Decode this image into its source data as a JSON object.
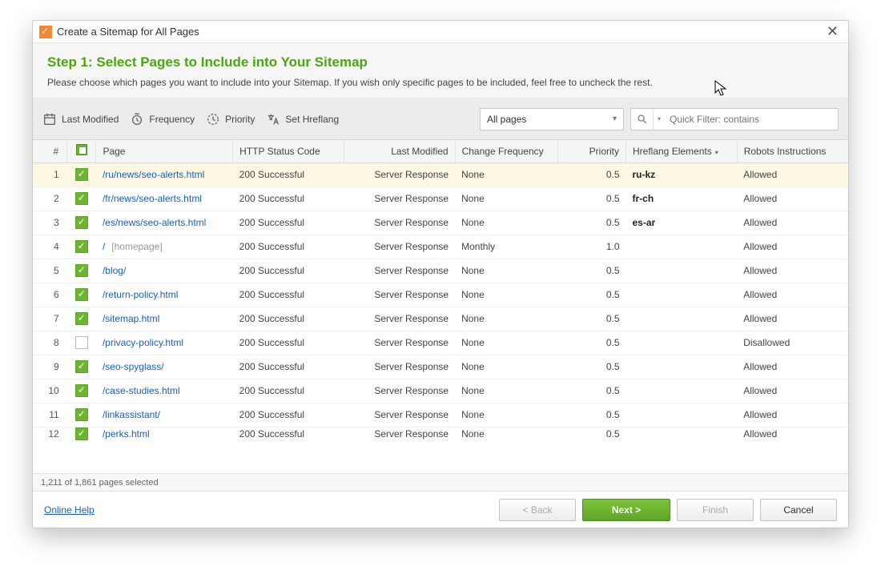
{
  "title": "Create a Sitemap for All Pages",
  "step_title": "Step 1: Select Pages to Include into Your Sitemap",
  "step_desc": "Please choose which pages you want to include into your Sitemap. If you wish only specific pages to be included, feel free to uncheck the rest.",
  "toolbar": {
    "last_modified": "Last Modified",
    "frequency": "Frequency",
    "priority": "Priority",
    "set_hreflang": "Set Hreflang"
  },
  "filter": {
    "dropdown": "All pages",
    "search_placeholder": "Quick Filter: contains"
  },
  "columns": {
    "num": "#",
    "page": "Page",
    "http": "HTTP Status Code",
    "modified": "Last Modified",
    "freq": "Change Frequency",
    "priority": "Priority",
    "hreflang": "Hreflang Elements",
    "robots": "Robots Instructions"
  },
  "rows": [
    {
      "n": "1",
      "chk": true,
      "page": "/ru/news/seo-alerts.html",
      "http": "200 Successful",
      "mod": "Server Response",
      "freq": "None",
      "pri": "0.5",
      "href": "ru-kz",
      "robots": "Allowed",
      "hl": true,
      "bold": true
    },
    {
      "n": "2",
      "chk": true,
      "page": "/fr/news/seo-alerts.html",
      "http": "200 Successful",
      "mod": "Server Response",
      "freq": "None",
      "pri": "0.5",
      "href": "fr-ch",
      "robots": "Allowed",
      "bold": true
    },
    {
      "n": "3",
      "chk": true,
      "page": "/es/news/seo-alerts.html",
      "http": "200 Successful",
      "mod": "Server Response",
      "freq": "None",
      "pri": "0.5",
      "href": "es-ar",
      "robots": "Allowed",
      "bold": true
    },
    {
      "n": "4",
      "chk": true,
      "page": "/",
      "page_note": "[homepage]",
      "http": "200 Successful",
      "mod": "Server Response",
      "freq": "Monthly",
      "pri": "1.0",
      "href": "",
      "robots": "Allowed"
    },
    {
      "n": "5",
      "chk": true,
      "page": "/blog/",
      "http": "200 Successful",
      "mod": "Server Response",
      "freq": "None",
      "pri": "0.5",
      "href": "",
      "robots": "Allowed"
    },
    {
      "n": "6",
      "chk": true,
      "page": "/return-policy.html",
      "http": "200 Successful",
      "mod": "Server Response",
      "freq": "None",
      "pri": "0.5",
      "href": "",
      "robots": "Allowed"
    },
    {
      "n": "7",
      "chk": true,
      "page": "/sitemap.html",
      "http": "200 Successful",
      "mod": "Server Response",
      "freq": "None",
      "pri": "0.5",
      "href": "",
      "robots": "Allowed"
    },
    {
      "n": "8",
      "chk": false,
      "page": "/privacy-policy.html",
      "http": "200 Successful",
      "mod": "Server Response",
      "freq": "None",
      "pri": "0.5",
      "href": "",
      "robots": "Disallowed"
    },
    {
      "n": "9",
      "chk": true,
      "page": "/seo-spyglass/",
      "http": "200 Successful",
      "mod": "Server Response",
      "freq": "None",
      "pri": "0.5",
      "href": "",
      "robots": "Allowed"
    },
    {
      "n": "10",
      "chk": true,
      "page": "/case-studies.html",
      "http": "200 Successful",
      "mod": "Server Response",
      "freq": "None",
      "pri": "0.5",
      "href": "",
      "robots": "Allowed"
    },
    {
      "n": "11",
      "chk": true,
      "page": "/linkassistant/",
      "http": "200 Successful",
      "mod": "Server Response",
      "freq": "None",
      "pri": "0.5",
      "href": "",
      "robots": "Allowed"
    },
    {
      "n": "12",
      "chk": true,
      "page": "/perks.html",
      "http": "200 Successful",
      "mod": "Server Response",
      "freq": "None",
      "pri": "0.5",
      "href": "",
      "robots": "Allowed",
      "cut": true
    }
  ],
  "status": "1,211 of 1,861 pages selected",
  "footer": {
    "help": "Online Help",
    "back": "< Back",
    "next": "Next >",
    "finish": "Finish",
    "cancel": "Cancel"
  }
}
